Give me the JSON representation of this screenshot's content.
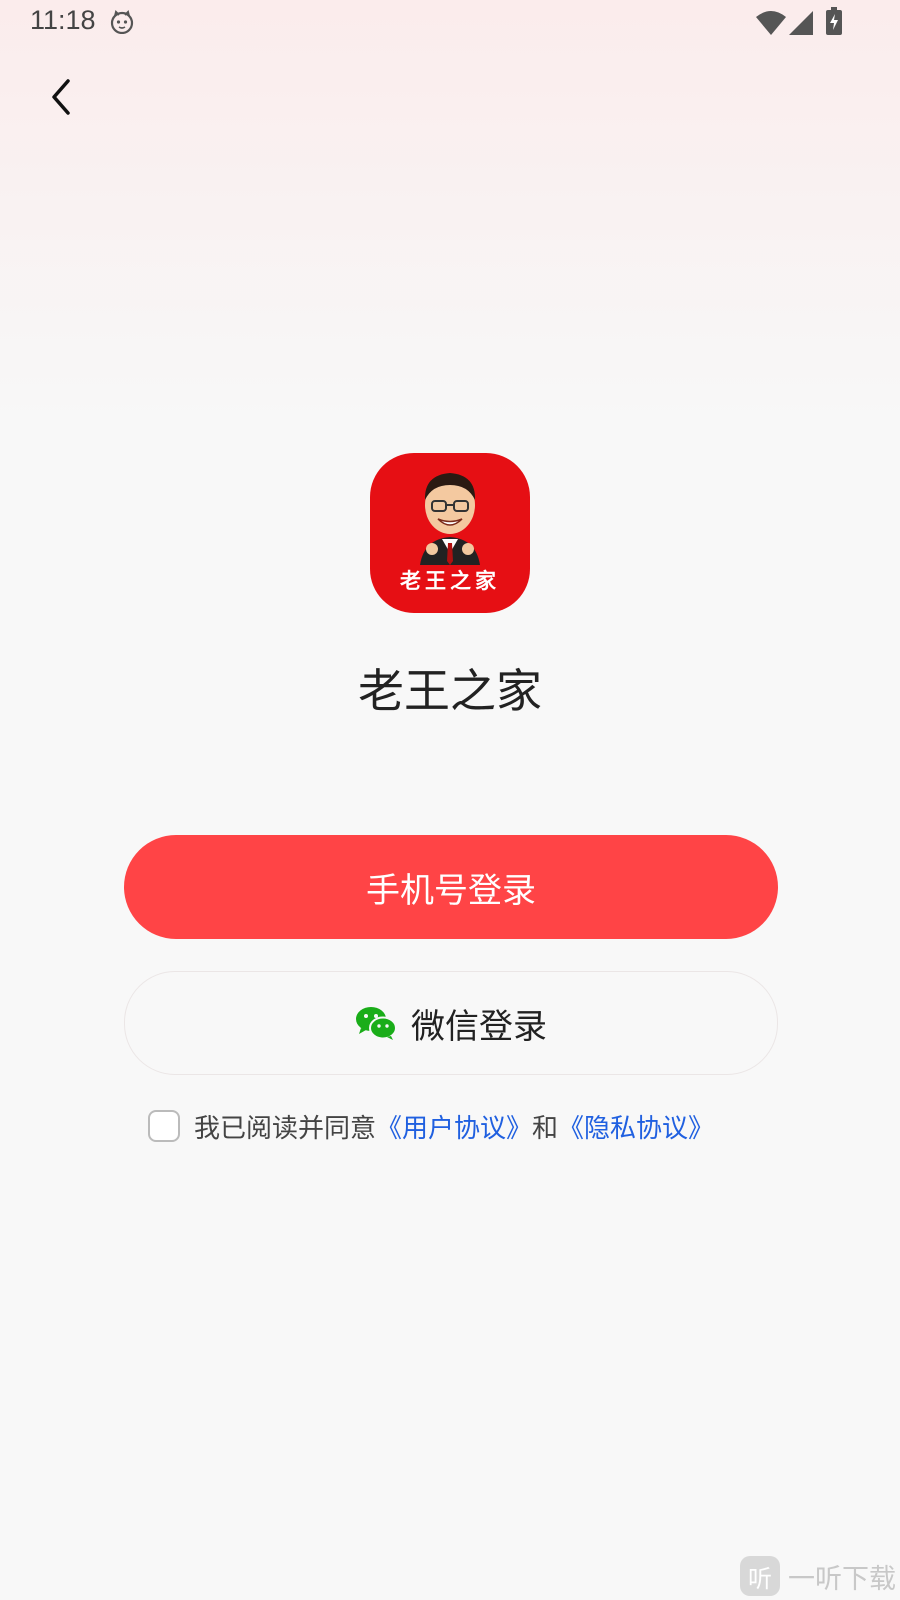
{
  "status_bar": {
    "time": "11:18",
    "icons": [
      "cat-notification-icon",
      "wifi-icon",
      "signal-icon",
      "battery-charging-icon"
    ]
  },
  "nav": {
    "back_icon": "chevron-left-icon"
  },
  "app": {
    "logo_caption": "老王之家",
    "name": "老王之家"
  },
  "login": {
    "phone_label": "手机号登录",
    "wechat_label": "微信登录",
    "wechat_icon": "wechat-icon"
  },
  "agreement": {
    "checked": false,
    "prefix": "我已阅读并同意",
    "user_agreement": "《用户协议》",
    "conjunction": "和",
    "privacy_agreement": "《隐私协议》"
  },
  "watermark": {
    "logo_glyph": "听",
    "text": "一听下载"
  },
  "colors": {
    "primary_button": "#ff4446",
    "logo_background": "#e60f14",
    "link": "#2060e0",
    "wechat_green": "#1aad19"
  }
}
